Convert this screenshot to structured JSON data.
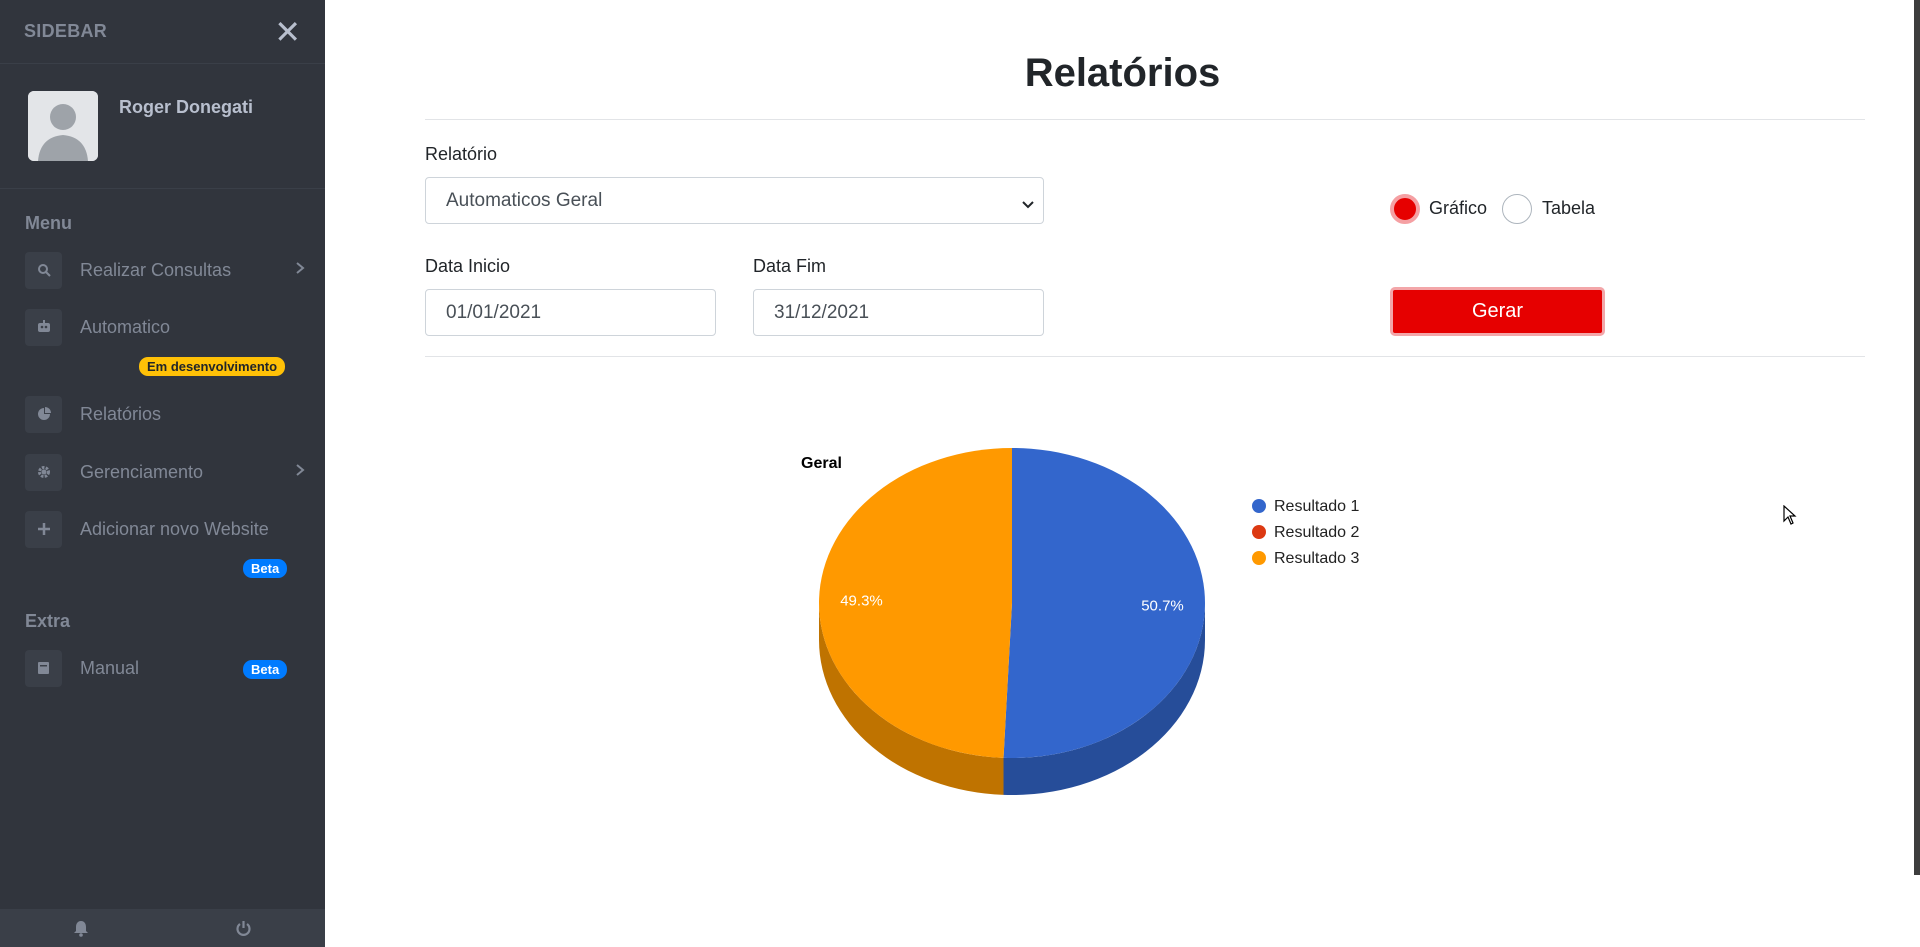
{
  "sidebar": {
    "title": "SIDEBAR",
    "user": {
      "name": "Roger Donegati"
    },
    "sections": {
      "menu": "Menu",
      "extra": "Extra"
    },
    "items": [
      {
        "label": "Realizar Consultas",
        "icon": "search-icon"
      },
      {
        "label": "Automatico",
        "icon": "robot-icon",
        "badge": "Em desenvolvimento"
      },
      {
        "label": "Relatórios",
        "icon": "chart-pie-icon"
      },
      {
        "label": "Gerenciamento",
        "icon": "gear-icon"
      },
      {
        "label": "Adicionar novo Website",
        "icon": "plus-icon",
        "badge": "Beta"
      },
      {
        "label": "Manual",
        "icon": "book-icon",
        "badge": "Beta"
      }
    ]
  },
  "main": {
    "title": "Relatórios",
    "form": {
      "relatorio_label": "Relatório",
      "relatorio_value": "Automaticos Geral",
      "data_inicio_label": "Data Inicio",
      "data_inicio_value": "01/01/2021",
      "data_fim_label": "Data Fim",
      "data_fim_value": "31/12/2021",
      "radio_grafico": "Gráfico",
      "radio_tabela": "Tabela",
      "selected_view": "Gráfico",
      "gerar_label": "Gerar"
    }
  },
  "chart_data": {
    "type": "pie",
    "title": "Geral",
    "categories": [
      "Resultado 1",
      "Resultado 2",
      "Resultado 3"
    ],
    "values": [
      50.7,
      0,
      49.3
    ],
    "data_labels": [
      "50.7%",
      "",
      "49.3%"
    ],
    "colors": [
      "#3366cc",
      "#dc3912",
      "#ff9900"
    ],
    "style": "3d",
    "legend": "right"
  },
  "colors": {
    "sidebar_bg": "#31353d",
    "accent": "#e60000",
    "badge_yellow": "#ffc107",
    "badge_blue": "#007bff"
  }
}
